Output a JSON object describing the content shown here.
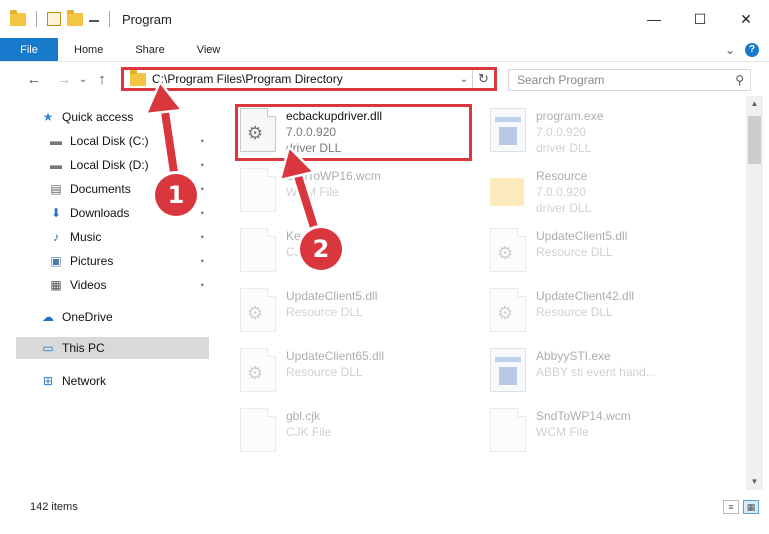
{
  "window": {
    "title": "Program",
    "minimize": "—",
    "maximize": "☐",
    "close": "✕"
  },
  "ribbon": {
    "tabs": [
      "File",
      "Home",
      "Share",
      "View"
    ],
    "expand": "⌄",
    "help": "?"
  },
  "address": {
    "back": "←",
    "forward": "→",
    "recent": "⌄",
    "up": "↑",
    "path": "C:\\Program Files\\Program Directory",
    "dropdown": "⌄",
    "refresh": "↻"
  },
  "search": {
    "placeholder": "Search Program",
    "icon": "⚲"
  },
  "sidebar": {
    "items": [
      {
        "label": "Quick access",
        "icon": "star-icon",
        "glyph": "★",
        "pinned": false
      },
      {
        "label": "Local Disk (C:)",
        "icon": "drive-icon",
        "glyph": "▬",
        "pinned": true
      },
      {
        "label": "Local Disk (D:)",
        "icon": "drive-icon",
        "glyph": "▬",
        "pinned": true
      },
      {
        "label": "Documents",
        "icon": "document-icon",
        "glyph": "▤",
        "pinned": true
      },
      {
        "label": "Downloads",
        "icon": "download-icon",
        "glyph": "⬇",
        "pinned": true
      },
      {
        "label": "Music",
        "icon": "music-icon",
        "glyph": "♪",
        "pinned": true
      },
      {
        "label": "Pictures",
        "icon": "picture-icon",
        "glyph": "▣",
        "pinned": true
      },
      {
        "label": "Videos",
        "icon": "video-icon",
        "glyph": "▦",
        "pinned": true
      },
      {
        "label": "OneDrive",
        "icon": "cloud-icon",
        "glyph": "☁",
        "pinned": false
      },
      {
        "label": "This PC",
        "icon": "computer-icon",
        "glyph": "▭",
        "pinned": false
      },
      {
        "label": "Network",
        "icon": "network-icon",
        "glyph": "⊞",
        "pinned": false
      }
    ],
    "pin_glyph": "📌"
  },
  "files": [
    {
      "name": "ecbackupdriver.dll",
      "version": "7.0.0.920",
      "type": "driver DLL",
      "kind": "dll",
      "highlight": true
    },
    {
      "name": "program.exe",
      "version": "7.0.0.920",
      "type": "driver DLL",
      "kind": "exe"
    },
    {
      "name": "SndToWP16.wcm",
      "version": "",
      "type": "WCM File",
      "kind": "dll"
    },
    {
      "name": "Resource",
      "version": "7.0.0.920",
      "type": "driver DLL",
      "kind": "folder"
    },
    {
      "name": "Kernel.cjk",
      "version": "",
      "type": "CJK File",
      "kind": "dll"
    },
    {
      "name": "UpdateClient5.dll",
      "version": "",
      "type": "Resource DLL",
      "kind": "dll"
    },
    {
      "name": "UpdateClient5.dll",
      "version": "",
      "type": "Resource DLL",
      "kind": "dll"
    },
    {
      "name": "UpdateClient42.dll",
      "version": "",
      "type": "Resource DLL",
      "kind": "dll"
    },
    {
      "name": "UpdateClient65.dll",
      "version": "",
      "type": "Resource DLL",
      "kind": "dll"
    },
    {
      "name": "AbbyySTI.exe",
      "version": "",
      "type": "ABBY sti event hand...",
      "kind": "exe"
    },
    {
      "name": "gbl.cjk",
      "version": "",
      "type": "CJK File",
      "kind": "dll"
    },
    {
      "name": "SndToWP14.wcm",
      "version": "",
      "type": "WCM File",
      "kind": "dll"
    }
  ],
  "status": {
    "items_count": "142 items"
  },
  "annotations": {
    "step1": "1",
    "step2": "2",
    "color": "#d9363e"
  }
}
